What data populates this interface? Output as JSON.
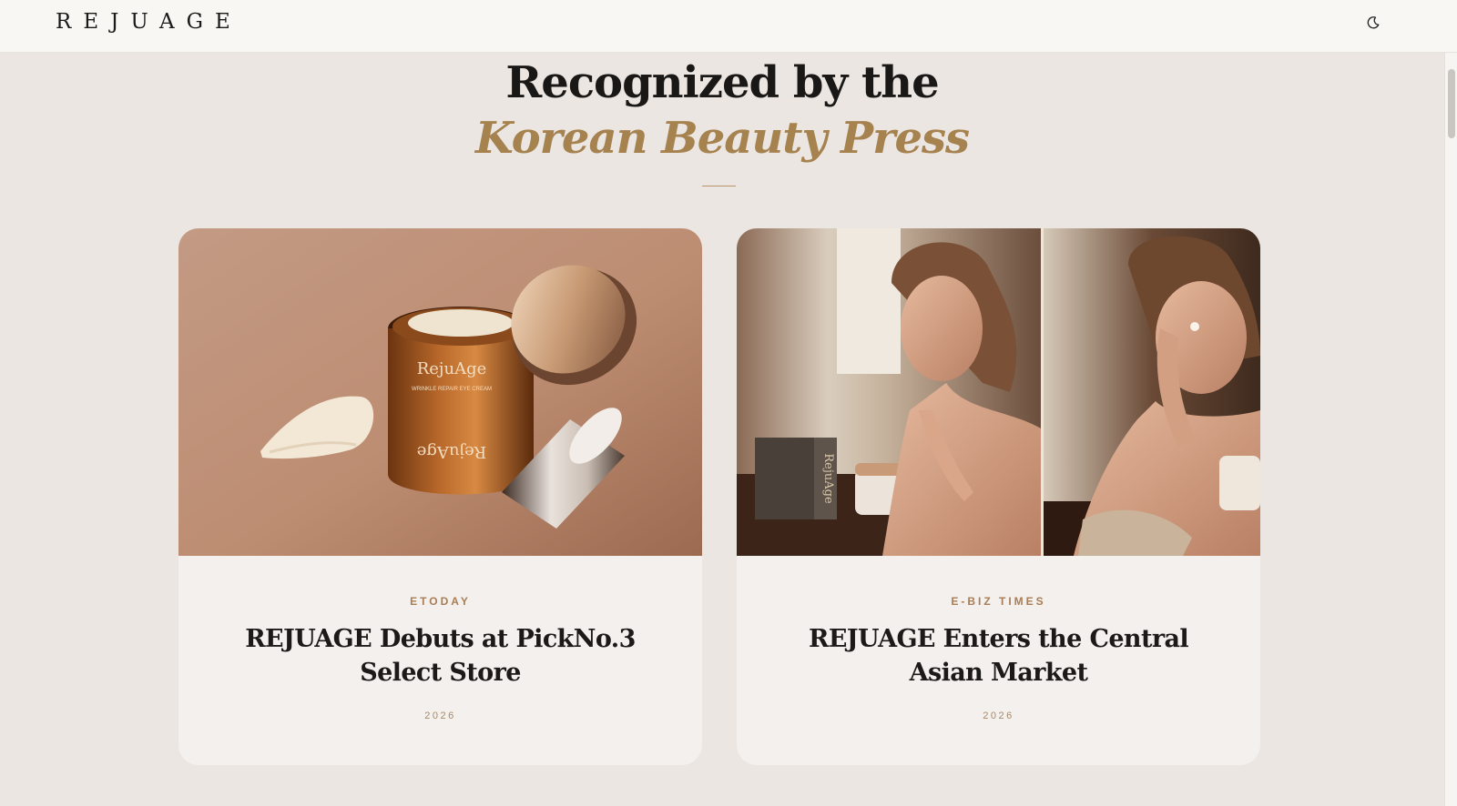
{
  "navbar": {
    "logo": "REJUAGE",
    "theme_toggle_icon": "moon-icon"
  },
  "section": {
    "title_line1": "Recognized by the",
    "title_line2": "Korean Beauty Press",
    "accent_color": "#a6824f"
  },
  "cards": [
    {
      "image_alt": "RejuAge jar with gold lid and cream swatch on peach backdrop",
      "image_icon": "product-photo",
      "source": "ETODAY",
      "title": "REJUAGE Debuts at PickNo.3 Select Store",
      "year": "2026"
    },
    {
      "image_alt": "Woman applying RejuAge cream at vanity",
      "image_icon": "lifestyle-photo",
      "source": "E-BIZ TIMES",
      "title": "REJUAGE Enters the Central Asian Market",
      "year": "2026"
    }
  ]
}
